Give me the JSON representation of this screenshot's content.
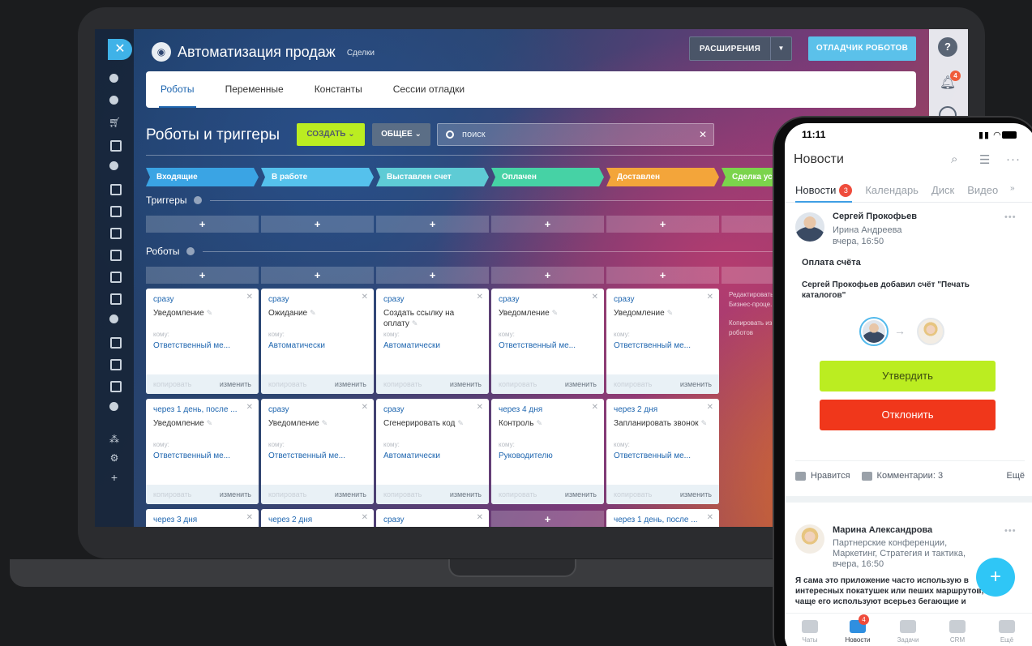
{
  "app": {
    "title": "Автоматизация продаж",
    "subtitle": "Сделки",
    "robot_icon": "robot-icon",
    "extensions_label": "РАСШИРЕНИЯ",
    "debugger_label": "ОТЛАДЧИК РОБОТОВ",
    "help_label": "?",
    "notif_count": "4"
  },
  "tabs": [
    {
      "label": "Роботы",
      "active": true
    },
    {
      "label": "Переменные",
      "active": false
    },
    {
      "label": "Константы",
      "active": false
    },
    {
      "label": "Сессии отладки",
      "active": false
    }
  ],
  "section": {
    "title": "Роботы и триггеры",
    "create_label": "СОЗДАТЬ",
    "common_label": "ОБЩЕЕ",
    "search_placeholder": "поиск",
    "triggers_label": "Триггеры",
    "robots_label": "Роботы"
  },
  "stages": [
    {
      "label": "Входящие",
      "color": "#3aa4e4"
    },
    {
      "label": "В работе",
      "color": "#55c1ec"
    },
    {
      "label": "Выставлен счет",
      "color": "#5ecbd5"
    },
    {
      "label": "Оплачен",
      "color": "#46d2a5"
    },
    {
      "label": "Доставлен",
      "color": "#f3a53a"
    },
    {
      "label": "Сделка успешна",
      "color": "#7bd44c"
    }
  ],
  "card_common": {
    "to_label": "кому:",
    "copy_label": "копировать",
    "edit_label": "изменить"
  },
  "cards_row1": [
    {
      "when": "сразу",
      "name": "Уведомление",
      "who": "Ответственный ме..."
    },
    {
      "when": "сразу",
      "name": "Ожидание",
      "who": "Автоматически"
    },
    {
      "when": "сразу",
      "name": "Создать ссылку на оплату",
      "who": "Автоматически"
    },
    {
      "when": "сразу",
      "name": "Уведомление",
      "who": "Ответственный ме..."
    },
    {
      "when": "сразу",
      "name": "Уведомление",
      "who": "Ответственный ме..."
    }
  ],
  "cards_row2": [
    {
      "when": "через 1 день, после ...",
      "name": "Уведомление",
      "who": "Ответственный ме..."
    },
    {
      "when": "сразу",
      "name": "Уведомление",
      "who": "Ответственный ме..."
    },
    {
      "when": "сразу",
      "name": "Сгенерировать код",
      "who": "Автоматически"
    },
    {
      "when": "через 4 дня",
      "name": "Контроль",
      "who": "Руководителю"
    },
    {
      "when": "через 2 дня",
      "name": "Запланировать звонок",
      "who": "Ответственный ме..."
    }
  ],
  "cards_row3": [
    {
      "when": "через 3 дня"
    },
    {
      "when": "через 2 дня"
    },
    {
      "when": "сразу"
    },
    {
      "when": "через 1 день, после ..."
    }
  ],
  "side_notes": {
    "edit": "Редактировать Бизнес-проце...",
    "copy": "Копировать из... роботов"
  },
  "phone": {
    "time": "11:11",
    "title": "Новости",
    "tabs": [
      {
        "label": "Новости",
        "active": true,
        "badge": "3"
      },
      {
        "label": "Календарь",
        "active": false
      },
      {
        "label": "Диск",
        "active": false
      },
      {
        "label": "Видео",
        "active": false
      }
    ],
    "post1": {
      "author": "Сергей Прокофьев",
      "recipient": "Ирина Андреева",
      "time": "вчера, 16:50",
      "heading": "Оплата счёта",
      "text": "Сергей Прокофьев добавил счёт \"Печать каталогов\"",
      "approve_label": "Утвердить",
      "reject_label": "Отклонить",
      "like_label": "Нравится",
      "comments_label": "Комментарии: 3",
      "more_label": "Ещё"
    },
    "post2": {
      "author": "Марина Александрова",
      "recipient": "Партнерские конференции, Маркетинг, Стратегия и тактика,",
      "time": "вчера, 16:50",
      "text": "Я сама это приложение часто использую в интересных покатушек или пеших маршрутов, еще чаще его используют всерьез бегающие и"
    },
    "fab_label": "+",
    "nav": [
      {
        "label": "Чаты",
        "active": false
      },
      {
        "label": "Новости",
        "active": true,
        "badge": "4"
      },
      {
        "label": "Задачи",
        "active": false
      },
      {
        "label": "CRM",
        "active": false
      },
      {
        "label": "Ещё",
        "active": false
      }
    ]
  },
  "colors": {
    "accent_blue": "#2067b0",
    "create_green": "#bbed21",
    "reject_red": "#f0371b",
    "fab_cyan": "#2fc6f6"
  }
}
